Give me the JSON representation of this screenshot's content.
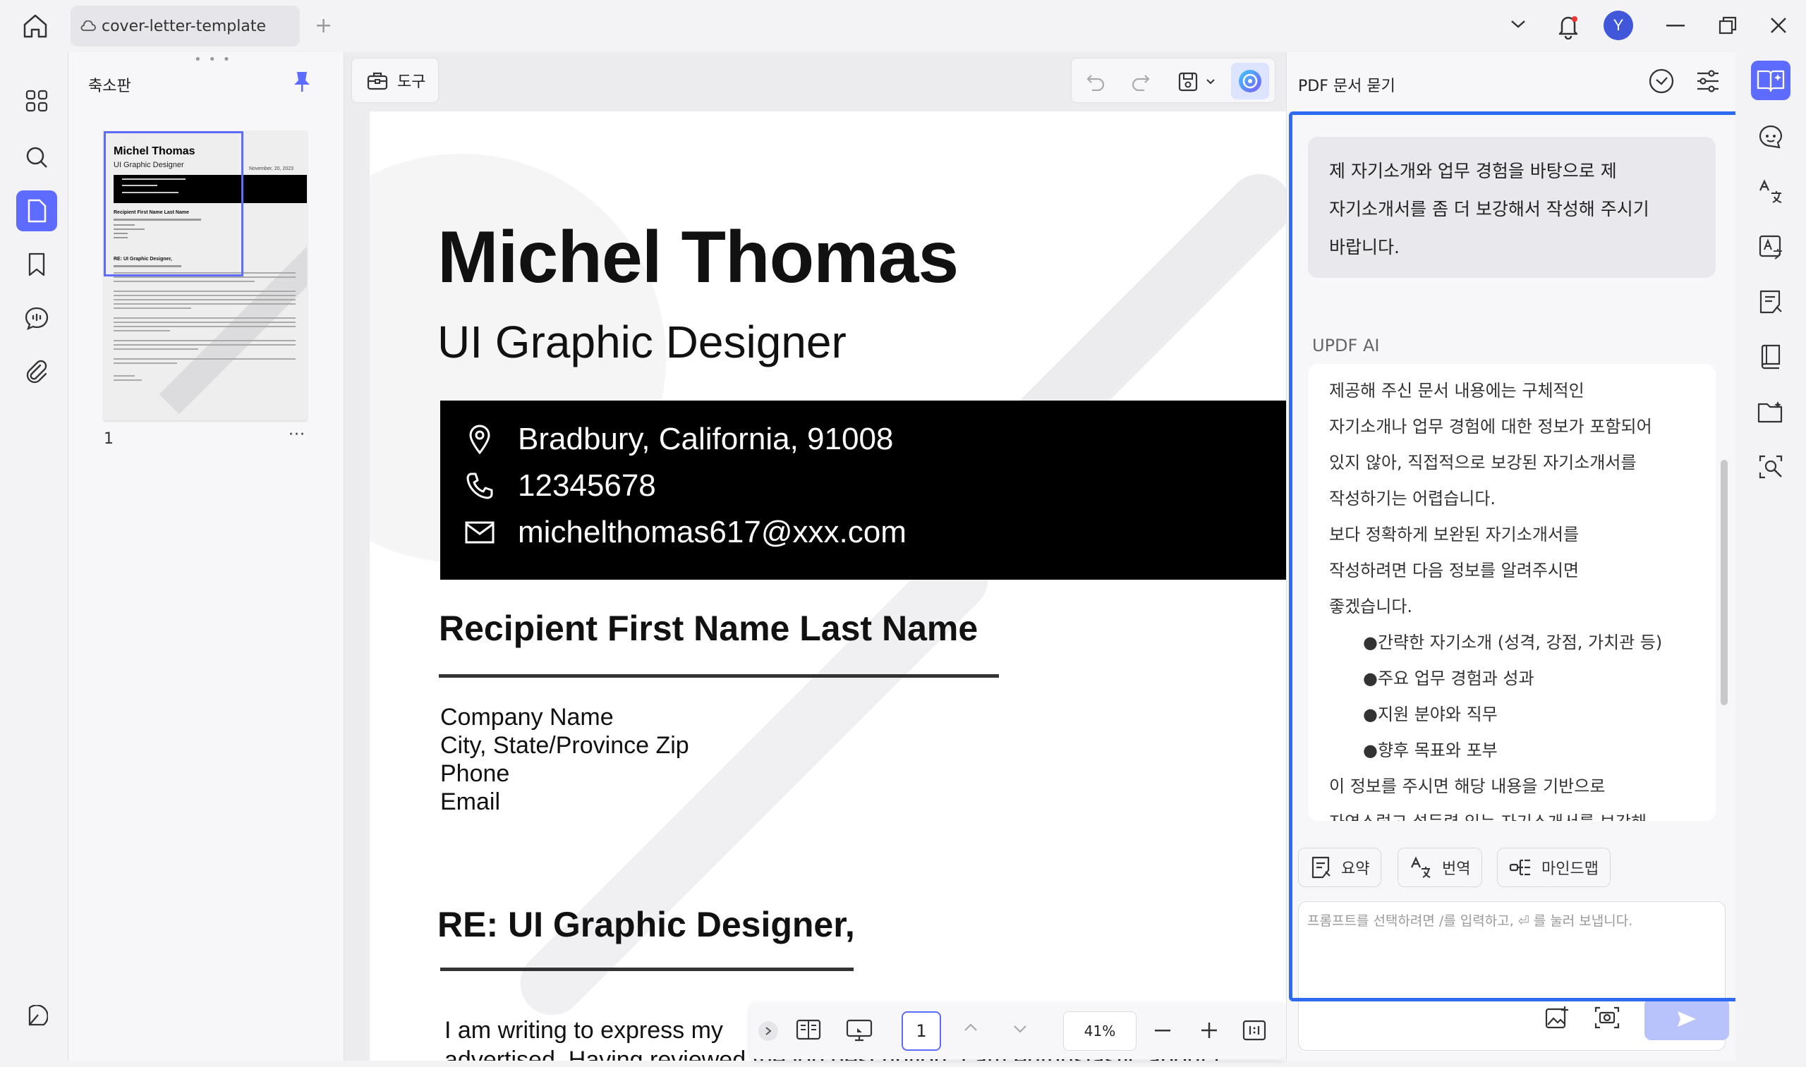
{
  "window": {
    "tab_title": "cover-letter-template",
    "new_tab": "+",
    "avatar_initial": "Y"
  },
  "thumbnails": {
    "title": "축소판",
    "page_number": "1",
    "more": "···"
  },
  "toolbar": {
    "tools_label": "도구"
  },
  "document": {
    "name": "Michel Thomas",
    "role": "UI Graphic Designer",
    "address": "Bradbury, California, 91008",
    "phone": "12345678",
    "email": "michelthomas617@xxx.com",
    "recipient": "Recipient First Name Last Name",
    "company": "Company Name",
    "city": "City, State/Province Zip",
    "phone_label": "Phone",
    "email_label": "Email",
    "re_line": "RE: UI Graphic Designer,",
    "body_line1": "I am writing to express my",
    "body_line2": "advertised. Having reviewed the job description, I am enthusiastic about t"
  },
  "thumbnail_preview": {
    "date": "November, 20, 2023",
    "recipient": "Recipient First Name Last Name",
    "re": "RE: UI Graphic Designer,"
  },
  "bottom_bar": {
    "page": "1",
    "zoom": "41%"
  },
  "ai_panel": {
    "title": "PDF 문서 묻기",
    "user_message_lines": [
      "제 자기소개와 업무 경험을 바탕으로 제",
      "자기소개서를 좀 더 보강해서 작성해 주시기",
      "바랍니다."
    ],
    "ai_label": "UPDF AI",
    "ai_lines": [
      "제공해 주신 문서 내용에는 구체적인",
      "자기소개나 업무 경험에 대한 정보가 포함되어",
      "있지 않아, 직접적으로 보강된 자기소개서를",
      "작성하기는 어렵습니다.",
      "보다 정확하게 보완된 자기소개서를",
      "작성하려면 다음 정보를 알려주시면",
      "좋겠습니다."
    ],
    "ai_bullets": [
      "●간략한 자기소개 (성격, 강점, 가치관 등)",
      "●주요 업무 경험과 성과",
      "●지원 분야와 직무",
      "●향후 목표와 포부"
    ],
    "ai_tail": [
      "이 정보를 주시면 해당 내용을 기반으로",
      "자연스럽고 설득력 있는 자기소개서를 보강해"
    ],
    "chips": [
      "요약",
      "번역",
      "마인드맵"
    ],
    "prompt_placeholder": "프롬프트를 선택하려면 /를 입력하고, ⏎ 를 눌러 보냅니다."
  },
  "colors": {
    "accent": "#5d6bff",
    "frame": "#2f6bf0",
    "send": "#b8c2fb"
  }
}
